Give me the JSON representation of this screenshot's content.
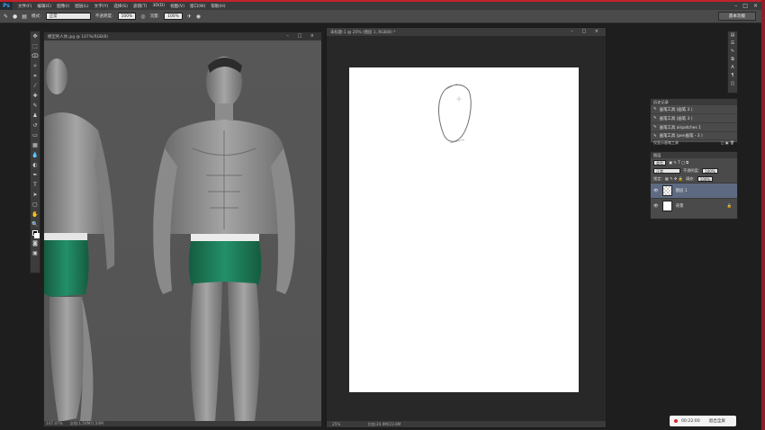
{
  "app": {
    "logo": "Ps"
  },
  "menu": [
    "文件(F)",
    "编辑(E)",
    "图像(I)",
    "图层(L)",
    "文字(Y)",
    "选择(S)",
    "滤镜(T)",
    "3D(D)",
    "视图(V)",
    "窗口(W)",
    "帮助(H)"
  ],
  "options": {
    "mode_label": "模式:",
    "mode_value": "正常",
    "opacity_label": "不透明度:",
    "opacity_value": "100%",
    "flow_label": "流量:",
    "flow_value": "100%",
    "workspace": "基本功能"
  },
  "doc_left": {
    "tab": "模型男人体.jpg @ 147%(RGB/8)",
    "zoom": "147.47%",
    "status": "文档:1.54M/1.54M"
  },
  "doc_right": {
    "tab": "未标题-1 @ 25% (图层 1, RGB/8) *",
    "zoom": "25%",
    "status": "文档:24.9M/23.8M"
  },
  "history": {
    "title": "历史记录",
    "items": [
      "画笔工具 (画笔 3 )",
      "画笔工具 (画笔 3 )",
      "画笔工具 airpatches 1",
      "画笔工具 (pen画笔 - 3 )"
    ],
    "footer": "仅显示画笔工具"
  },
  "layers": {
    "title": "图层",
    "kind": "类型",
    "blend": "正常",
    "opacity_label": "不透明度:",
    "opacity_value": "100%",
    "lock_label": "锁定:",
    "fill_label": "填充:",
    "fill_value": "100%",
    "items": [
      {
        "name": "图层 1",
        "selected": true
      },
      {
        "name": "背景",
        "selected": false
      }
    ]
  },
  "recorder": {
    "time": "00:22:00",
    "stop_label": "退出全屏"
  },
  "colors": {
    "accent": "#c4222a",
    "shorts": "#1f8a5e",
    "selected_layer": "#5d6a82"
  }
}
